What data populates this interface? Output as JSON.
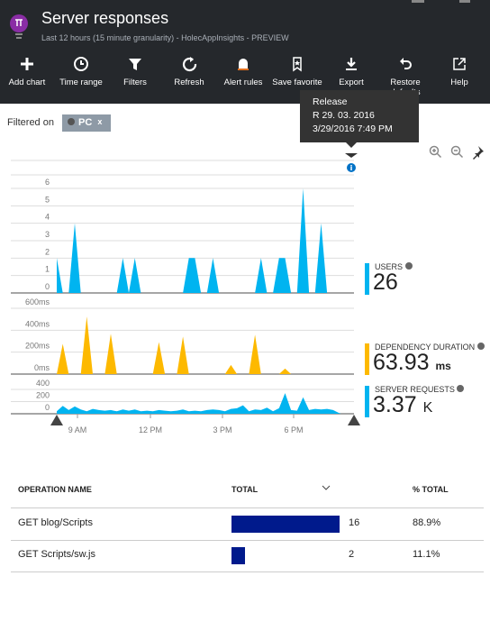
{
  "header": {
    "title": "Server responses",
    "subtitle": "Last 12 hours (15 minute granularity) - HolecAppInsights - PREVIEW",
    "icon": "lightbulb-icon"
  },
  "toolbar": [
    {
      "label": "Add chart",
      "icon": "plus-icon"
    },
    {
      "label": "Time range",
      "icon": "clock-icon"
    },
    {
      "label": "Filters",
      "icon": "filter-icon"
    },
    {
      "label": "Refresh",
      "icon": "refresh-icon"
    },
    {
      "label": "Alert rules",
      "icon": "bell-icon"
    },
    {
      "label": "Save favorite",
      "icon": "bookmark-icon"
    },
    {
      "label": "Export",
      "icon": "download-icon"
    },
    {
      "label": "Restore defaults",
      "icon": "undo-icon"
    },
    {
      "label": "Help",
      "icon": "external-link-icon"
    }
  ],
  "filter": {
    "label": "Filtered on",
    "chip": "PC",
    "chip_close": "x"
  },
  "tooltip": {
    "title": "Release",
    "line1": "R 29. 03. 2016",
    "line2": "3/29/2016 7:49 PM"
  },
  "metrics": [
    {
      "label": "USERS",
      "value": "26",
      "unit": "",
      "color": "#00b4f0"
    },
    {
      "label": "DEPENDENCY DURATION",
      "value": "63.93",
      "unit": "ms",
      "color": "#fdb900"
    },
    {
      "label": "SERVER REQUESTS",
      "value": "3.37",
      "unit": "K",
      "color": "#00b4f0"
    }
  ],
  "chart_data": {
    "type": "area",
    "x_ticks": [
      "9 AM",
      "12 PM",
      "3 PM",
      "6 PM"
    ],
    "granularity": "15 minute",
    "series": [
      {
        "name": "USERS",
        "color": "#00b4f0",
        "y_ticks": [
          "0",
          "1",
          "2",
          "3",
          "4",
          "5",
          "6"
        ],
        "ylim": [
          0,
          6
        ],
        "values": [
          2,
          0,
          0,
          4,
          0,
          0,
          0,
          0,
          0,
          0,
          0,
          2,
          0,
          2,
          0,
          0,
          0,
          0,
          0,
          0,
          0,
          0,
          2,
          2,
          0,
          0,
          2,
          0,
          0,
          0,
          0,
          0,
          0,
          0,
          2,
          0,
          0,
          2,
          2,
          0,
          0,
          6,
          0,
          0,
          4,
          0,
          0,
          0
        ]
      },
      {
        "name": "DEPENDENCY DURATION",
        "color": "#fdb900",
        "y_ticks": [
          "0ms",
          "200ms",
          "400ms",
          "600ms"
        ],
        "ylim": [
          0,
          600
        ],
        "values": [
          0,
          275,
          0,
          0,
          0,
          525,
          0,
          0,
          0,
          367,
          0,
          0,
          0,
          0,
          0,
          0,
          0,
          292,
          0,
          0,
          0,
          342,
          0,
          0,
          0,
          0,
          0,
          0,
          0,
          83,
          0,
          0,
          0,
          358,
          0,
          0,
          0,
          0,
          50,
          0,
          0,
          0,
          0,
          0,
          0,
          0,
          0,
          0
        ]
      },
      {
        "name": "SERVER REQUESTS",
        "color": "#00b4f0",
        "y_ticks": [
          "0",
          "200",
          "400"
        ],
        "ylim": [
          0,
          400
        ],
        "values": [
          40,
          130,
          60,
          120,
          70,
          40,
          80,
          60,
          50,
          60,
          40,
          70,
          50,
          70,
          40,
          50,
          40,
          60,
          50,
          40,
          50,
          70,
          40,
          50,
          40,
          60,
          70,
          60,
          40,
          80,
          90,
          140,
          40,
          70,
          60,
          100,
          40,
          90,
          340,
          60,
          50,
          270,
          60,
          80,
          70,
          80,
          60,
          10
        ]
      }
    ]
  },
  "table": {
    "columns": [
      "OPERATION NAME",
      "TOTAL",
      "% TOTAL"
    ],
    "rows": [
      {
        "name": "GET blog/Scripts",
        "total": 16,
        "total_label": "16",
        "pct": "88.9%"
      },
      {
        "name": "GET Scripts/sw.js",
        "total": 2,
        "total_label": "2",
        "pct": "11.1%"
      }
    ]
  }
}
